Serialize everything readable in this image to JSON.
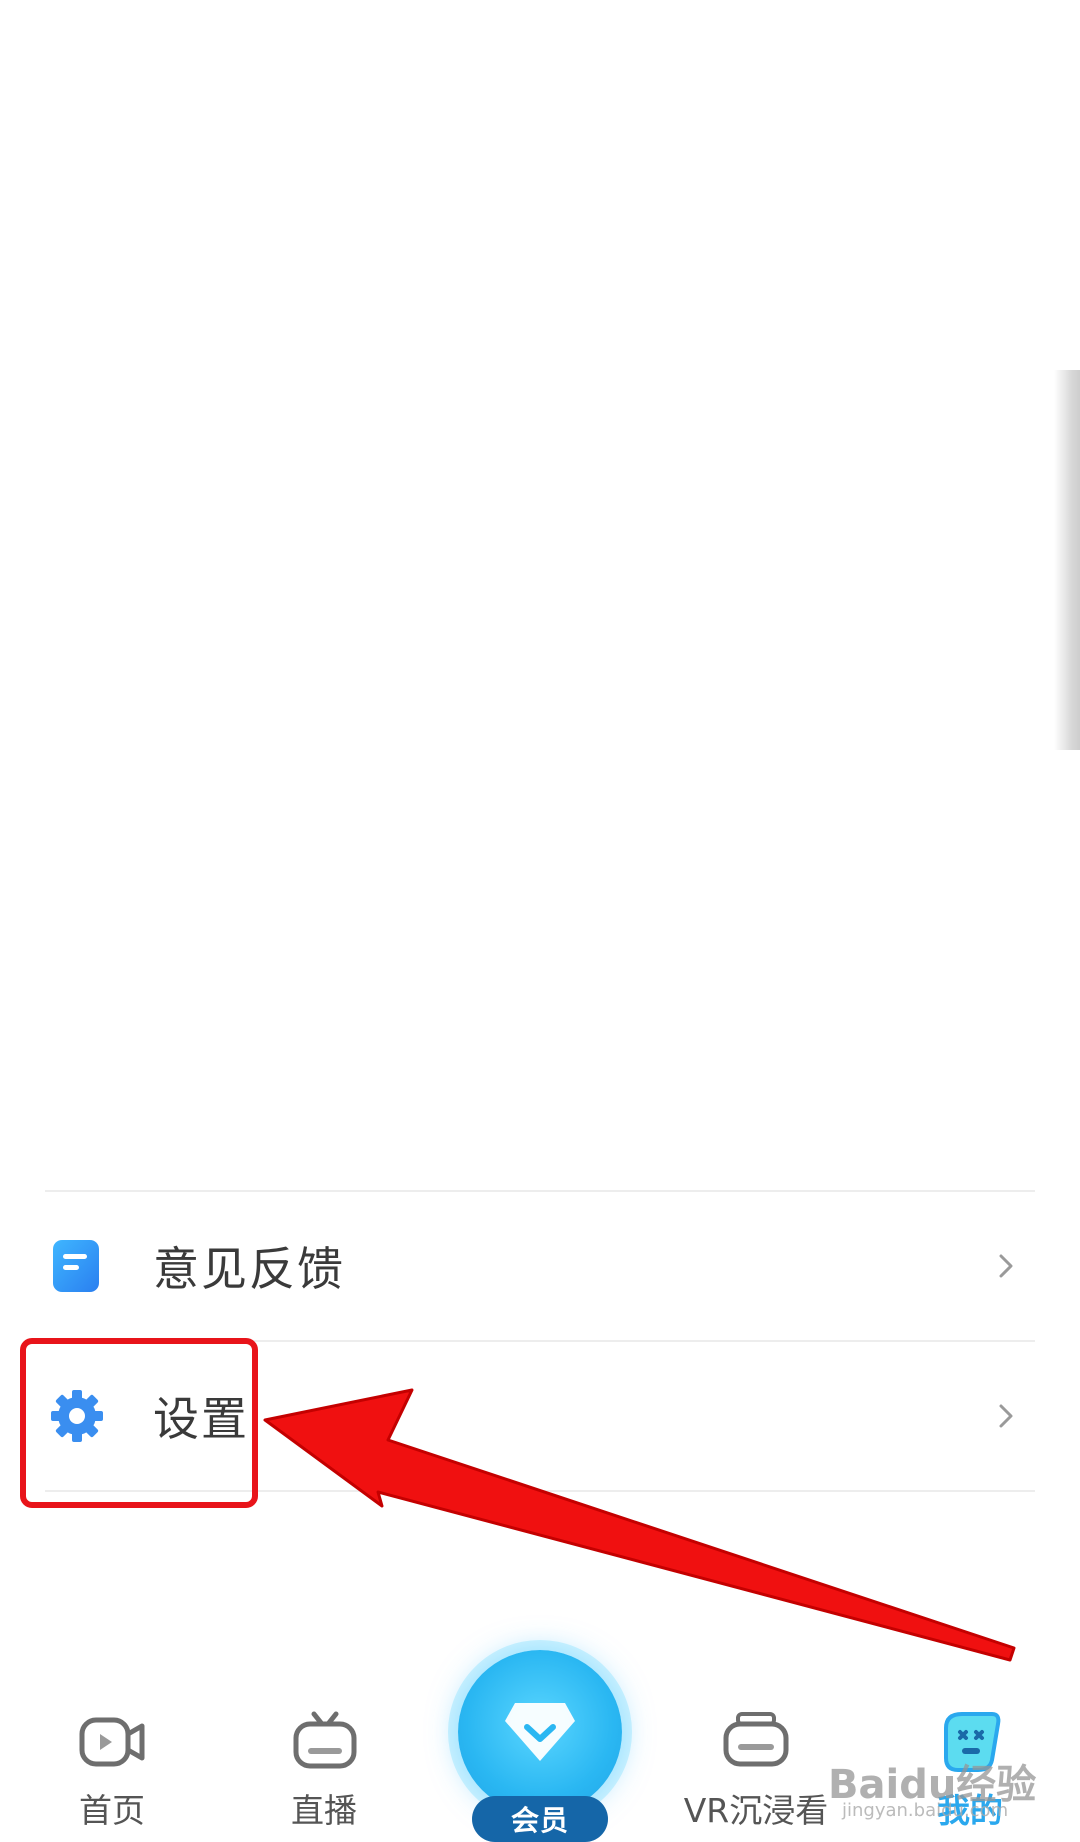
{
  "menu": {
    "items": [
      {
        "label": "意见反馈",
        "icon": "feedback-doc-icon"
      },
      {
        "label": "设置",
        "icon": "gear-icon"
      }
    ]
  },
  "bottom_nav": {
    "items": [
      {
        "label": "首页",
        "icon": "video-camera-icon"
      },
      {
        "label": "直播",
        "icon": "tv-icon"
      },
      {
        "label": "会员",
        "icon": "diamond-icon"
      },
      {
        "label": "VR沉浸看",
        "icon": "vr-headset-icon"
      },
      {
        "label": "我的",
        "icon": "profile-face-icon"
      }
    ],
    "active_index": 4
  },
  "annotation": {
    "box_color": "#e8141a",
    "arrow_color": "#f01010"
  },
  "watermark": {
    "main": "Baidu经验",
    "sub": "jingyan.baidu.com"
  },
  "colors": {
    "accent": "#2aa8ee",
    "vip_badge": "#1566a8",
    "text": "#3a3a3a"
  }
}
